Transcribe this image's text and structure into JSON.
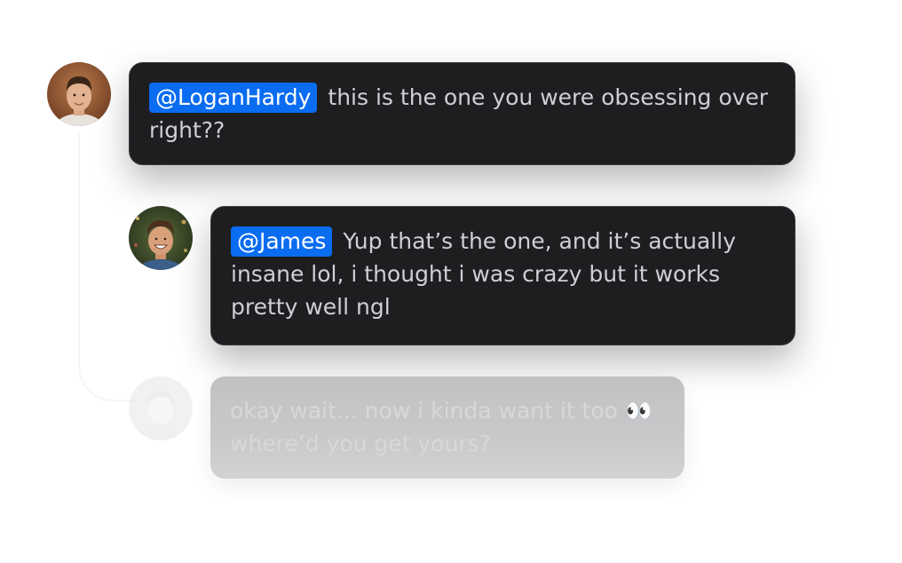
{
  "messages": [
    {
      "mention": "@LoganHardy",
      "text": "this is the one you were obsessing over right??"
    },
    {
      "mention": "@James",
      "text": "Yup that’s the one, and it’s actually insane lol, i thought i was crazy but it works pretty well ngl"
    },
    {
      "text": "okay wait... now i kinda want it too",
      "emoji": "👀",
      "text2": "where’d you get yours?"
    }
  ],
  "colors": {
    "mention_bg": "#0a6cf0",
    "bubble_bg": "#1e1e21",
    "faded_bubble_bg": "#c4c4c6"
  },
  "icons": {
    "avatar1": "avatar-man-short-hair",
    "avatar2": "avatar-man-smiling-curly-hair",
    "avatar3": "avatar-faded"
  }
}
